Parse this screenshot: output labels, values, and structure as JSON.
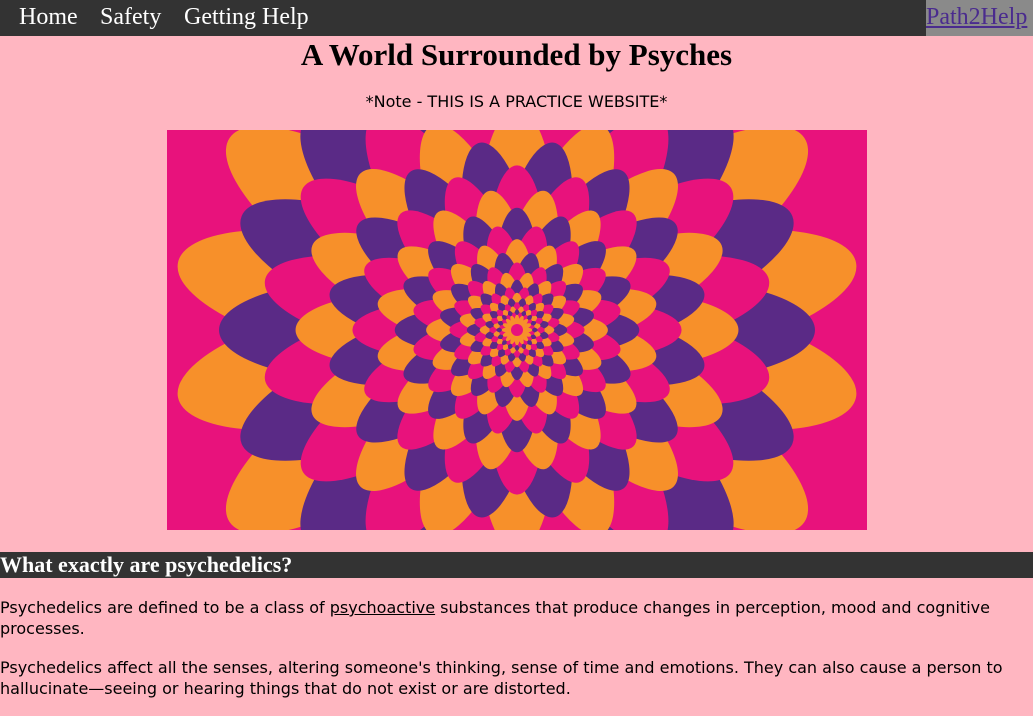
{
  "nav": {
    "links": [
      {
        "label": "Home"
      },
      {
        "label": "Safety"
      },
      {
        "label": "Getting Help"
      }
    ],
    "brand": "Path2Help"
  },
  "header": {
    "title": "A World Surrounded by Psyches",
    "note": "*Note - THIS IS A PRACTICE WEBSITE*"
  },
  "section": {
    "heading": "What exactly are psychedelics?",
    "p1_before": "Psychedelics are defined to be a class of ",
    "p1_link": "psychoactive",
    "p1_after": " substances that produce changes in perception, mood and cognitive processes.",
    "p2": "Psychedelics affect all the senses, altering someone's thinking, sense of time and emotions. They can also cause a person to hallucinate—seeing or hearing things that do not exist or are distorted."
  },
  "colors": {
    "page_background": "#ffb6c1",
    "nav_background": "#333333",
    "brand_box": "#8a8a8a",
    "brand_link": "#4a2b8e",
    "hero_purple": "#5a2a86",
    "hero_pink": "#e8127c",
    "hero_orange": "#f7902a"
  },
  "icons": {
    "hero_image": "psychedelic-flower-pattern"
  }
}
